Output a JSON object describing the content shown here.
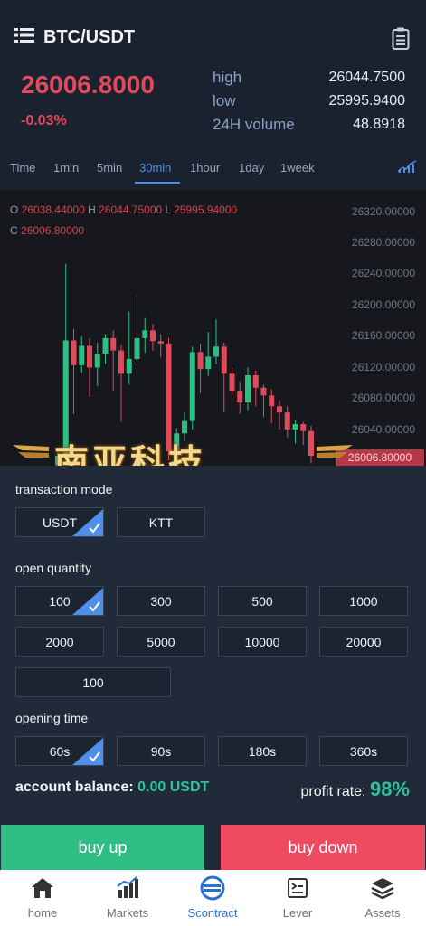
{
  "header": {
    "pair": "BTC/USDT",
    "price": "26006.8000",
    "change": "-0.03%",
    "stats": [
      {
        "label": "high",
        "value": "26044.7500"
      },
      {
        "label": "low",
        "value": "25995.9400"
      },
      {
        "label": "24H volume",
        "value": "48.8918"
      }
    ]
  },
  "tabs": [
    "Time",
    "1min",
    "5min",
    "30min",
    "1hour",
    "1day",
    "1week"
  ],
  "active_tab": "30min",
  "chart": {
    "ohlc": {
      "o_label": "O",
      "o": "26038.44000",
      "h_label": "H",
      "h": "26044.75000",
      "l_label": "L",
      "l": "25995.94000",
      "c_label": "C",
      "c": "26006.80000"
    },
    "y_ticks": [
      "26320.00000",
      "26280.00000",
      "26240.00000",
      "26200.00000",
      "26160.00000",
      "26120.00000",
      "26080.00000",
      "26040.00000"
    ],
    "last_price": "26006.80000",
    "watermark": "南亚科技",
    "colors": {
      "up": "#2ebe83",
      "down": "#e04a5a",
      "bg": "#17181d"
    },
    "candles": [
      {
        "o": 25994,
        "c": 26006,
        "h": 26014,
        "l": 25994
      },
      {
        "o": 26006,
        "c": 26155,
        "h": 26254,
        "l": 26006
      },
      {
        "o": 26155,
        "c": 26123,
        "h": 26170,
        "l": 26060
      },
      {
        "o": 26123,
        "c": 26148,
        "h": 26160,
        "l": 26113
      },
      {
        "o": 26148,
        "c": 26120,
        "h": 26158,
        "l": 26082
      },
      {
        "o": 26120,
        "c": 26138,
        "h": 26152,
        "l": 26096
      },
      {
        "o": 26138,
        "c": 26158,
        "h": 26163,
        "l": 26125
      },
      {
        "o": 26158,
        "c": 26142,
        "h": 26168,
        "l": 26090
      },
      {
        "o": 26142,
        "c": 26112,
        "h": 26150,
        "l": 26050
      },
      {
        "o": 26112,
        "c": 26131,
        "h": 26192,
        "l": 26098
      },
      {
        "o": 26131,
        "c": 26158,
        "h": 26212,
        "l": 26122
      },
      {
        "o": 26158,
        "c": 26168,
        "h": 26184,
        "l": 26139
      },
      {
        "o": 26168,
        "c": 26154,
        "h": 26176,
        "l": 26142
      },
      {
        "o": 26154,
        "c": 26151,
        "h": 26163,
        "l": 26133
      },
      {
        "o": 26151,
        "c": 26012,
        "h": 26158,
        "l": 26000
      },
      {
        "o": 26012,
        "c": 26035,
        "h": 26042,
        "l": 25998
      },
      {
        "o": 26035,
        "c": 26051,
        "h": 26062,
        "l": 26025
      },
      {
        "o": 26051,
        "c": 26140,
        "h": 26147,
        "l": 26040
      },
      {
        "o": 26140,
        "c": 26118,
        "h": 26151,
        "l": 26087
      },
      {
        "o": 26118,
        "c": 26134,
        "h": 26166,
        "l": 26109
      },
      {
        "o": 26134,
        "c": 26147,
        "h": 26182,
        "l": 26124
      },
      {
        "o": 26147,
        "c": 26112,
        "h": 26152,
        "l": 26062
      },
      {
        "o": 26112,
        "c": 26090,
        "h": 26119,
        "l": 26084
      },
      {
        "o": 26090,
        "c": 26075,
        "h": 26102,
        "l": 26060
      },
      {
        "o": 26075,
        "c": 26110,
        "h": 26120,
        "l": 26065
      },
      {
        "o": 26110,
        "c": 26094,
        "h": 26116,
        "l": 26070
      },
      {
        "o": 26094,
        "c": 26084,
        "h": 26098,
        "l": 26056
      },
      {
        "o": 26084,
        "c": 26070,
        "h": 26092,
        "l": 26048
      },
      {
        "o": 26070,
        "c": 26062,
        "h": 26078,
        "l": 26040
      },
      {
        "o": 26062,
        "c": 26040,
        "h": 26070,
        "l": 26030
      },
      {
        "o": 26040,
        "c": 26047,
        "h": 26052,
        "l": 26022
      },
      {
        "o": 26047,
        "c": 26038,
        "h": 26050,
        "l": 26020
      },
      {
        "o": 26038,
        "c": 26006,
        "h": 26045,
        "l": 25996
      }
    ]
  },
  "transaction_mode": {
    "label": "transaction mode",
    "options": [
      "USDT",
      "KTT"
    ],
    "selected": "USDT"
  },
  "open_quantity": {
    "label": "open quantity",
    "options": [
      "100",
      "300",
      "500",
      "1000",
      "2000",
      "5000",
      "10000",
      "20000"
    ],
    "selected": "100",
    "custom_value": "100"
  },
  "opening_time": {
    "label": "opening time",
    "options": [
      "60s",
      "90s",
      "180s",
      "360s"
    ],
    "selected": "60s"
  },
  "account": {
    "label": "account balance:",
    "value": "0.00 USDT"
  },
  "profit": {
    "label": "profit rate:",
    "value": "98%"
  },
  "actions": {
    "buy_up": "buy up",
    "buy_down": "buy down"
  },
  "nav": [
    {
      "label": "home",
      "icon": "home-icon"
    },
    {
      "label": "Markets",
      "icon": "markets-icon"
    },
    {
      "label": "Scontract",
      "icon": "contract-icon"
    },
    {
      "label": "Lever",
      "icon": "lever-icon"
    },
    {
      "label": "Assets",
      "icon": "assets-icon"
    }
  ],
  "nav_active": "Scontract"
}
